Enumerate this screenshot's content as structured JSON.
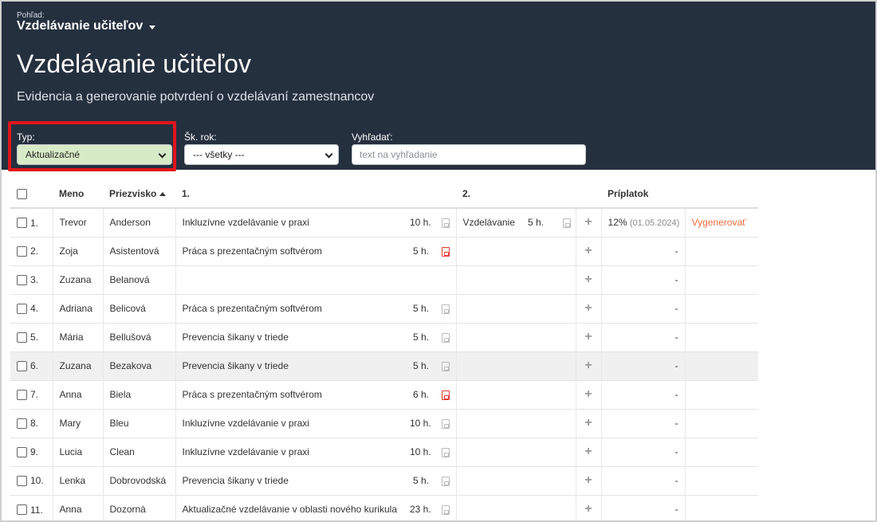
{
  "header": {
    "view_caption": "Pohľad:",
    "view_name": "Vzdelávanie učiteľov",
    "title": "Vzdelávanie učiteľov",
    "subtitle": "Evidencia a generovanie potvrdení o vzdelávaní zamestnancov"
  },
  "filters": {
    "type_label": "Typ:",
    "type_value": "Aktualizačné",
    "year_label": "Šk. rok:",
    "year_value": "--- všetky ---",
    "search_label": "Vyhľadať:",
    "search_placeholder": "text na vyhľadanie"
  },
  "table": {
    "columns": {
      "first_name": "Meno",
      "last_name": "Priezvisko",
      "edu1": "1.",
      "edu2": "2.",
      "bonus": "Príplatok"
    },
    "rows": [
      {
        "num": "1.",
        "first": "Trevor",
        "last": "Anderson",
        "course1": "Inkluzívne vzdelávanie v praxi",
        "hours1": "10 h.",
        "pdf1": "gray",
        "course2": "Vzdelávanie",
        "hours2": "5 h.",
        "pdf2": "gray",
        "bonus": "12%",
        "bonus_date": "(01.05.2024)",
        "action": "Vygenerovať"
      },
      {
        "num": "2.",
        "first": "Zoja",
        "last": "Asistentová",
        "course1": "Práca s prezentačným softvérom",
        "hours1": "5 h.",
        "pdf1": "red",
        "course2": "",
        "hours2": "",
        "pdf2": "",
        "bonus": "-",
        "bonus_date": "",
        "action": ""
      },
      {
        "num": "3.",
        "first": "Zuzana",
        "last": "Belanová",
        "course1": "",
        "hours1": "",
        "pdf1": "",
        "course2": "",
        "hours2": "",
        "pdf2": "",
        "bonus": "-",
        "bonus_date": "",
        "action": ""
      },
      {
        "num": "4.",
        "first": "Adriana",
        "last": "Belicová",
        "course1": "Práca s prezentačným softvérom",
        "hours1": "5 h.",
        "pdf1": "gray",
        "course2": "",
        "hours2": "",
        "pdf2": "",
        "bonus": "-",
        "bonus_date": "",
        "action": ""
      },
      {
        "num": "5.",
        "first": "Mária",
        "last": "Bellušová",
        "course1": "Prevencia šikany v triede",
        "hours1": "5 h.",
        "pdf1": "gray",
        "course2": "",
        "hours2": "",
        "pdf2": "",
        "bonus": "-",
        "bonus_date": "",
        "action": ""
      },
      {
        "num": "6.",
        "first": "Zuzana",
        "last": "Bezakova",
        "course1": "Prevencia šikany v triede",
        "hours1": "5 h.",
        "pdf1": "gray",
        "course2": "",
        "hours2": "",
        "pdf2": "",
        "bonus": "-",
        "bonus_date": "",
        "action": ""
      },
      {
        "num": "7.",
        "first": "Anna",
        "last": "Biela",
        "course1": "Práca s prezentačným softvérom",
        "hours1": "6 h.",
        "pdf1": "red",
        "course2": "",
        "hours2": "",
        "pdf2": "",
        "bonus": "-",
        "bonus_date": "",
        "action": ""
      },
      {
        "num": "8.",
        "first": "Mary",
        "last": "Bleu",
        "course1": "Inkluzívne vzdelávanie v praxi",
        "hours1": "10 h.",
        "pdf1": "gray",
        "course2": "",
        "hours2": "",
        "pdf2": "",
        "bonus": "-",
        "bonus_date": "",
        "action": ""
      },
      {
        "num": "9.",
        "first": "Lucia",
        "last": "Clean",
        "course1": "Inkluzívne vzdelávanie v praxi",
        "hours1": "10 h.",
        "pdf1": "gray",
        "course2": "",
        "hours2": "",
        "pdf2": "",
        "bonus": "-",
        "bonus_date": "",
        "action": ""
      },
      {
        "num": "10.",
        "first": "Lenka",
        "last": "Dobrovodská",
        "course1": "Prevencia šikany v triede",
        "hours1": "5 h.",
        "pdf1": "gray",
        "course2": "",
        "hours2": "",
        "pdf2": "",
        "bonus": "-",
        "bonus_date": "",
        "action": ""
      },
      {
        "num": "11.",
        "first": "Anna",
        "last": "Dozorná",
        "course1": "Aktualizačné vzdelávanie v oblasti nového kurikula",
        "hours1": "23 h.",
        "pdf1": "gray",
        "course2": "",
        "hours2": "",
        "pdf2": "",
        "bonus": "-",
        "bonus_date": "",
        "action": ""
      }
    ]
  },
  "colors": {
    "header_bg": "#25303f",
    "highlight_border": "#e0151b",
    "type_select_bg": "#d8ebc7",
    "action_link": "#ef6c3a",
    "pdf_active": "#e53935"
  }
}
